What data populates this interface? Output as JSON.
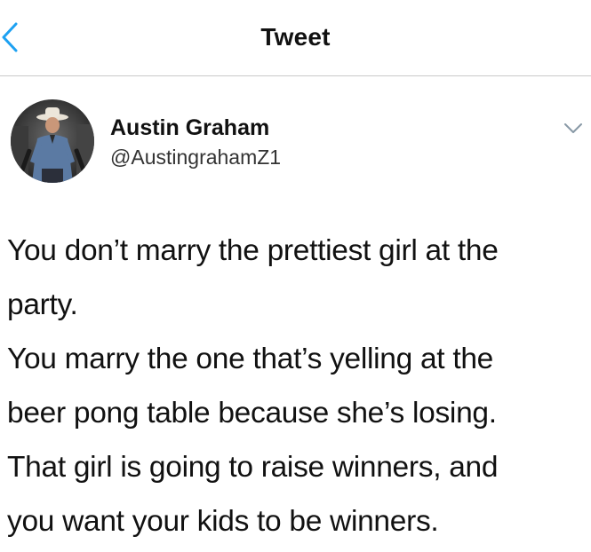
{
  "nav": {
    "title": "Tweet",
    "back_icon": "chevron-left-icon"
  },
  "author": {
    "display_name": "Austin Graham",
    "handle": "@AustingrahamZ1",
    "avatar_icon": "profile-photo"
  },
  "menu": {
    "icon": "chevron-down-icon"
  },
  "tweet": {
    "lines": [
      "You don’t marry the prettiest girl at the",
      "party.",
      "You marry the one that’s yelling at the",
      "beer pong table because she’s losing.",
      "That girl is going to raise winners, and",
      "you want your kids to be winners."
    ]
  },
  "colors": {
    "text": "#111111",
    "secondary_text": "#333333",
    "accent_blue": "#1da1f2",
    "divider": "#c9c9c9",
    "icon_gray": "#8899a6"
  }
}
